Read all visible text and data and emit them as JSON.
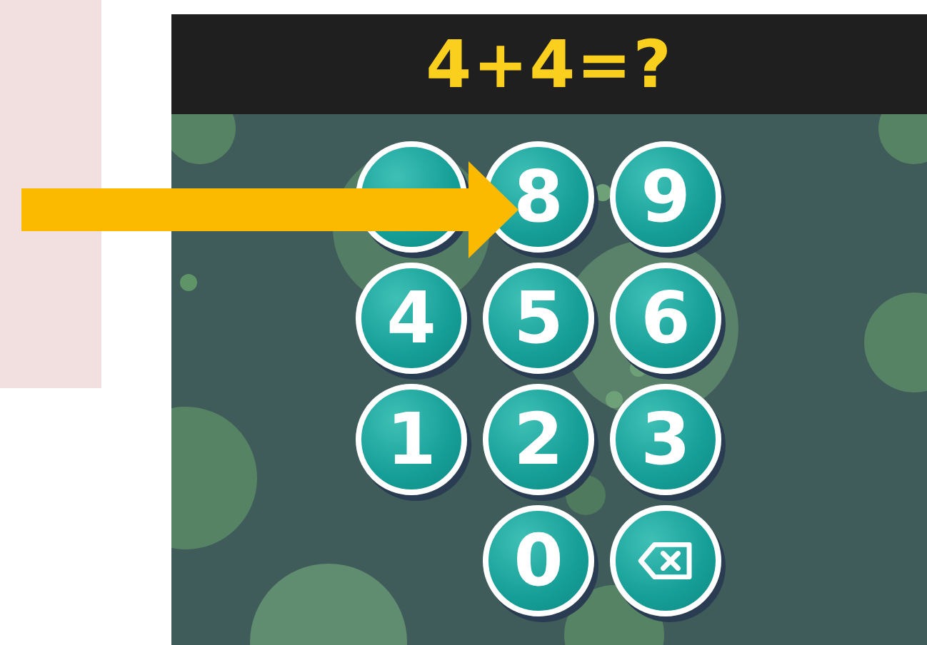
{
  "question": "4+4=?",
  "keypad": [
    [
      {
        "kind": "covered"
      },
      {
        "kind": "digit",
        "label": "8"
      },
      {
        "kind": "digit",
        "label": "9"
      }
    ],
    [
      {
        "kind": "digit",
        "label": "4"
      },
      {
        "kind": "digit",
        "label": "5"
      },
      {
        "kind": "digit",
        "label": "6"
      }
    ],
    [
      {
        "kind": "digit",
        "label": "1"
      },
      {
        "kind": "digit",
        "label": "2"
      },
      {
        "kind": "digit",
        "label": "3"
      }
    ],
    [
      {
        "kind": "digit",
        "label": "0"
      },
      {
        "kind": "backspace"
      }
    ]
  ]
}
